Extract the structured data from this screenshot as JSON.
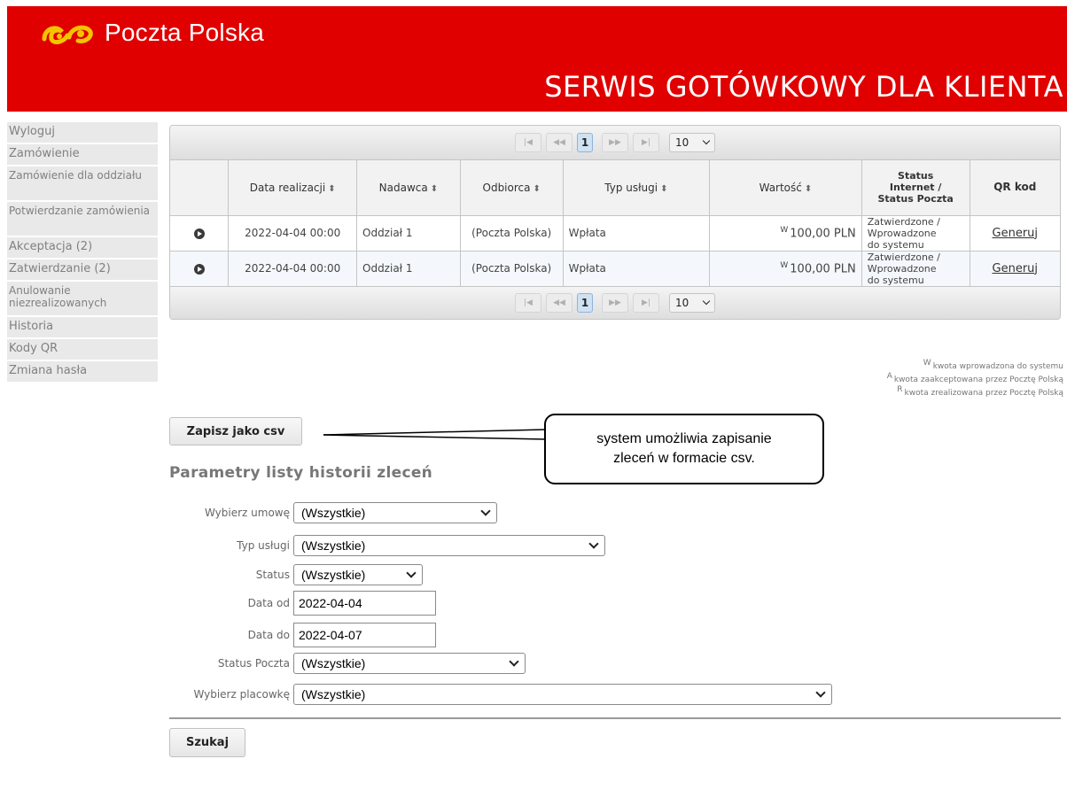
{
  "header": {
    "brand": "Poczta Polska",
    "title": "SERWIS GOTÓWKOWY DLA KLIENTA",
    "brand_color": "#e00000"
  },
  "sidebar": {
    "items": [
      {
        "label": "Wyloguj"
      },
      {
        "label": "Zamówienie"
      },
      {
        "label": "Zamówienie dla oddziału"
      },
      {
        "label": "Potwierdzanie zamówienia"
      },
      {
        "label": "Akceptacja (2)"
      },
      {
        "label": "Zatwierdzanie (2)"
      },
      {
        "label": "Anulowanie niezrealizowanych"
      },
      {
        "label": "Historia"
      },
      {
        "label": "Kody QR"
      },
      {
        "label": "Zmiana hasła"
      }
    ]
  },
  "pager": {
    "first": "|◀",
    "prev": "◀◀",
    "page": "1",
    "next": "▶▶",
    "last": "▶|",
    "page_size": "10"
  },
  "table": {
    "sort_icon": "sort-arrows-icon",
    "columns": {
      "date": "Data realizacji",
      "sender": "Nadawca",
      "recipient": "Odbiorca",
      "service": "Typ usługi",
      "value": "Wartość",
      "status_line1": "Status",
      "status_line2": "Internet /",
      "status_line3": "Status Poczta",
      "qr": "QR kod"
    },
    "rows": [
      {
        "date": "2022-04-04 00:00",
        "sender": "Oddział 1",
        "recipient": "(Poczta Polska)",
        "service": "Wpłata",
        "value_marker": "W",
        "value": "100,00 PLN",
        "status_line1": "Zatwierdzone /",
        "status_line2": "Wprowadzone",
        "status_line3": "do systemu",
        "qr_link": "Generuj"
      },
      {
        "date": "2022-04-04 00:00",
        "sender": "Oddział 1",
        "recipient": "(Poczta Polska)",
        "service": "Wpłata",
        "value_marker": "W",
        "value": "100,00 PLN",
        "status_line1": "Zatwierdzone /",
        "status_line2": "Wprowadzone",
        "status_line3": "do systemu",
        "qr_link": "Generuj"
      }
    ]
  },
  "legend": {
    "w_marker": "W",
    "w_text": "kwota wprowadzona do systemu",
    "a_marker": "A",
    "a_text": "kwota zaakceptowana przez Pocztę Polską",
    "r_marker": "R",
    "r_text": "kwota zrealizowana przez Pocztę Polską"
  },
  "actions": {
    "csv_label": "Zapisz jako csv",
    "search_label": "Szukaj"
  },
  "callout": {
    "line1": "system umożliwia zapisanie",
    "line2": "zleceń w formacie csv."
  },
  "filters": {
    "title": "Parametry listy historii zleceń",
    "contract_label": "Wybierz umowę",
    "contract_value": "(Wszystkie)",
    "service_label": "Typ usługi",
    "service_value": "(Wszystkie)",
    "status_label": "Status",
    "status_value": "(Wszystkie)",
    "date_from_label": "Data od",
    "date_from_value": "2022-04-04",
    "date_to_label": "Data do",
    "date_to_value": "2022-04-07",
    "post_status_label": "Status Poczta",
    "post_status_value": "(Wszystkie)",
    "office_label": "Wybierz placowkę",
    "office_value": "(Wszystkie)"
  }
}
